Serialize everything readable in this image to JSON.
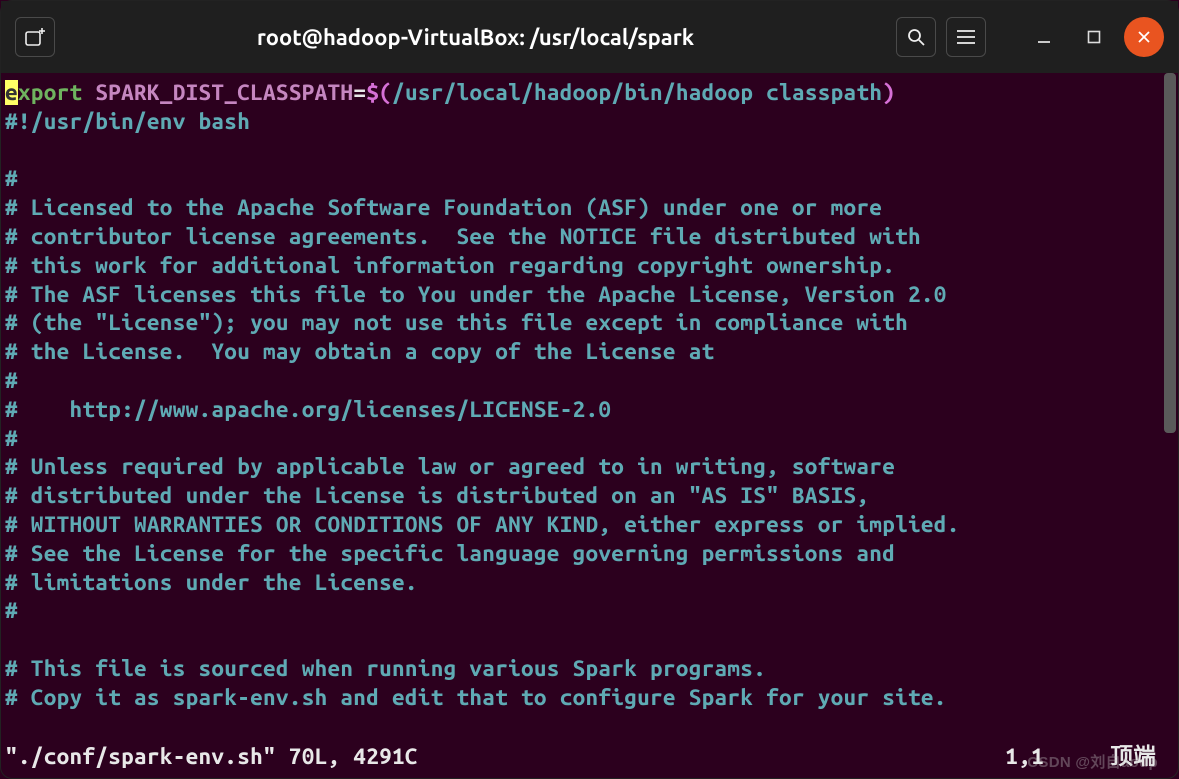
{
  "titlebar": {
    "title": "root@hadoop-VirtualBox: /usr/local/spark",
    "icons": {
      "newtab": "new-tab-icon",
      "search": "search-icon",
      "menu": "menu-icon",
      "minimize": "minimize-icon",
      "maximize": "maximize-icon",
      "close": "close-icon"
    }
  },
  "editor": {
    "line1": {
      "cursor_char": "e",
      "kw": "xport ",
      "var": "SPARK_DIST_CLASSPATH",
      "eq": "=",
      "cmd_open": "$(",
      "path": "/usr/local/hadoop/bin/hadoop classpath",
      "cmd_close": ")"
    },
    "lines": [
      "#!/usr/bin/env bash",
      "",
      "#",
      "# Licensed to the Apache Software Foundation (ASF) under one or more",
      "# contributor license agreements.  See the NOTICE file distributed with",
      "# this work for additional information regarding copyright ownership.",
      "# The ASF licenses this file to You under the Apache License, Version 2.0",
      "# (the \"License\"); you may not use this file except in compliance with",
      "# the License.  You may obtain a copy of the License at",
      "#",
      "#    http://www.apache.org/licenses/LICENSE-2.0",
      "#",
      "# Unless required by applicable law or agreed to in writing, software",
      "# distributed under the License is distributed on an \"AS IS\" BASIS,",
      "# WITHOUT WARRANTIES OR CONDITIONS OF ANY KIND, either express or implied.",
      "# See the License for the specific language governing permissions and",
      "# limitations under the License.",
      "#",
      "",
      "# This file is sourced when running various Spark programs.",
      "# Copy it as spark-env.sh and edit that to configure Spark for your site."
    ]
  },
  "status": {
    "filename": "\"./conf/spark-env.sh\" 70L, 4291C",
    "position": "1,1",
    "corner": "顶端"
  },
  "watermark": "CSDN @刘自aoup"
}
